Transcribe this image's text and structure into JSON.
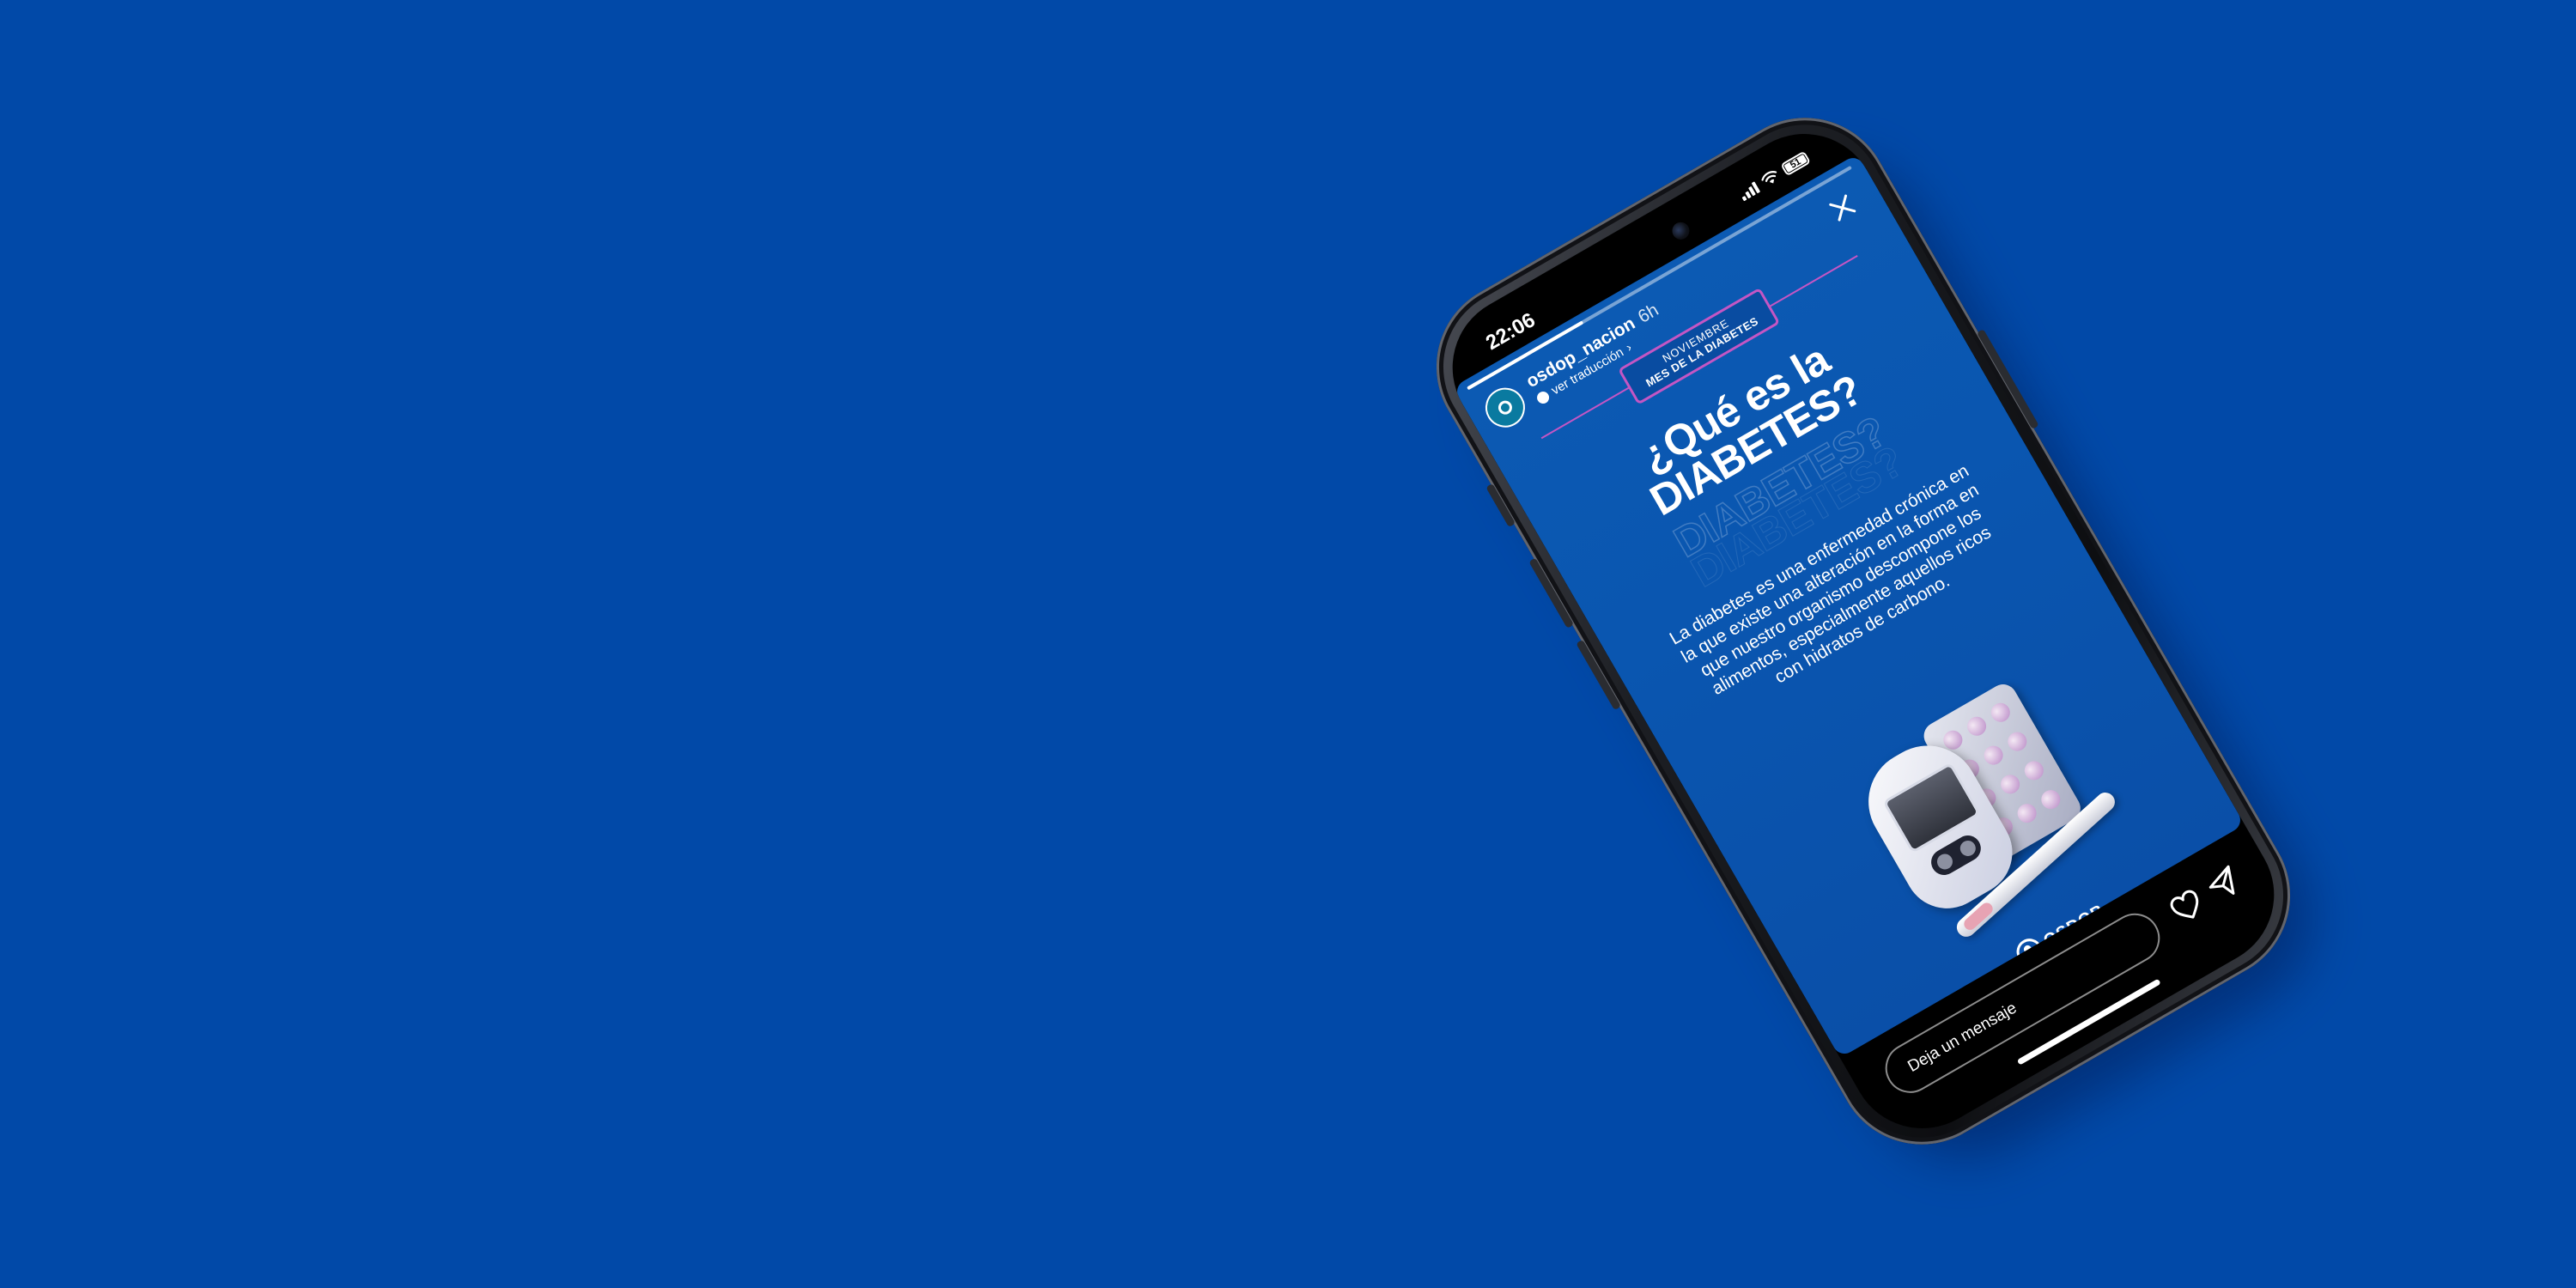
{
  "status_bar": {
    "time": "22:06",
    "battery_level": "51"
  },
  "story": {
    "progress": 0.3,
    "username": "osdop_nacion",
    "time_ago": "6h",
    "translate_label": "ver traducción",
    "badge": {
      "line1": "NOVIEMBRE",
      "line2": "MES DE LA DIABETES",
      "color": "#c456c4"
    },
    "title_line1": "¿Qué es la",
    "title_line2": "DIABETES?",
    "body": "La diabetes es una enfermedad crónica en la que existe una alteración en la forma en que nuestro organismo descompone los alimentos, especialmente aquellos ricos con hidratos de carbono.",
    "logo_text": "OSDOP"
  },
  "reply": {
    "placeholder": "Deja un mensaje"
  },
  "colors": {
    "background": "#0149a8",
    "story_bg": "#0a56b0"
  }
}
